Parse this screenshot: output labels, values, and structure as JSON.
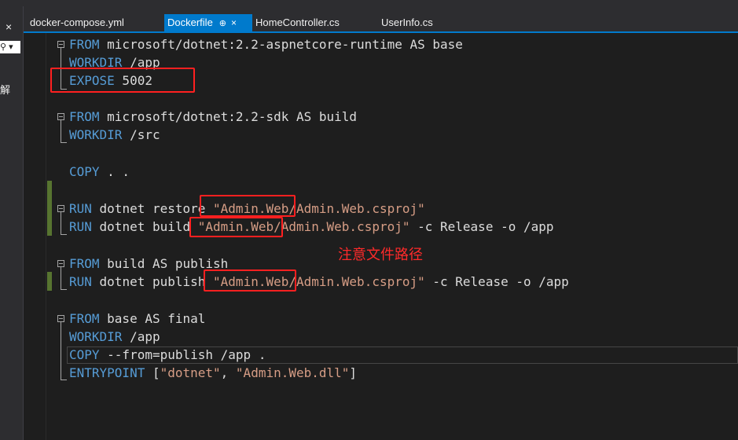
{
  "tabs": [
    {
      "label": "docker-compose.yml",
      "active": false
    },
    {
      "label": "Dockerfile",
      "active": true,
      "pin_glyph": "⊕",
      "close_glyph": "×"
    },
    {
      "label": "HomeController.cs",
      "active": false
    },
    {
      "label": "UserInfo.cs",
      "active": false
    }
  ],
  "left_panel": {
    "close_glyph": "×",
    "search_glyph": "⚲ ▾",
    "truncated_char": "解"
  },
  "code_lines": [
    {
      "kw": "FROM",
      "rest": " microsoft/dotnet:2.2-aspnetcore-runtime AS base"
    },
    {
      "kw": "WORKDIR",
      "rest": " /app"
    },
    {
      "kw": "EXPOSE",
      "rest": " 5002"
    },
    {
      "kw": "FROM",
      "rest": " microsoft/dotnet:2.2-sdk AS build"
    },
    {
      "kw": "WORKDIR",
      "rest": " /src"
    },
    {
      "kw": "COPY",
      "rest": " . ."
    },
    {
      "kw": "RUN",
      "rest": " dotnet restore ",
      "str": "\"Admin.Web/Admin.Web.csproj\"",
      "tail": ""
    },
    {
      "kw": "RUN",
      "rest": " dotnet build ",
      "str": "\"Admin.Web/Admin.Web.csproj\"",
      "tail": " -c Release -o /app"
    },
    {
      "kw": "FROM",
      "rest": " build AS publish"
    },
    {
      "kw": "RUN",
      "rest": " dotnet publish ",
      "str": "\"Admin.Web/Admin.Web.csproj\"",
      "tail": " -c Release -o /app"
    },
    {
      "kw": "FROM",
      "rest": " base AS final"
    },
    {
      "kw": "WORKDIR",
      "rest": " /app"
    },
    {
      "kw": "COPY",
      "rest": " --from=publish /app ."
    },
    {
      "kw": "ENTRYPOINT",
      "rest": " [",
      "str": "\"dotnet\"",
      "mid": ", ",
      "str2": "\"Admin.Web.dll\"",
      "tail": "]"
    }
  ],
  "annotation": {
    "note": "注意文件路径",
    "color": "#ff2020"
  },
  "colors": {
    "keyword": "#569cd6",
    "string": "#d69d85",
    "text": "#dcdcdc",
    "accent": "#007acc",
    "change_bar": "#577430"
  }
}
